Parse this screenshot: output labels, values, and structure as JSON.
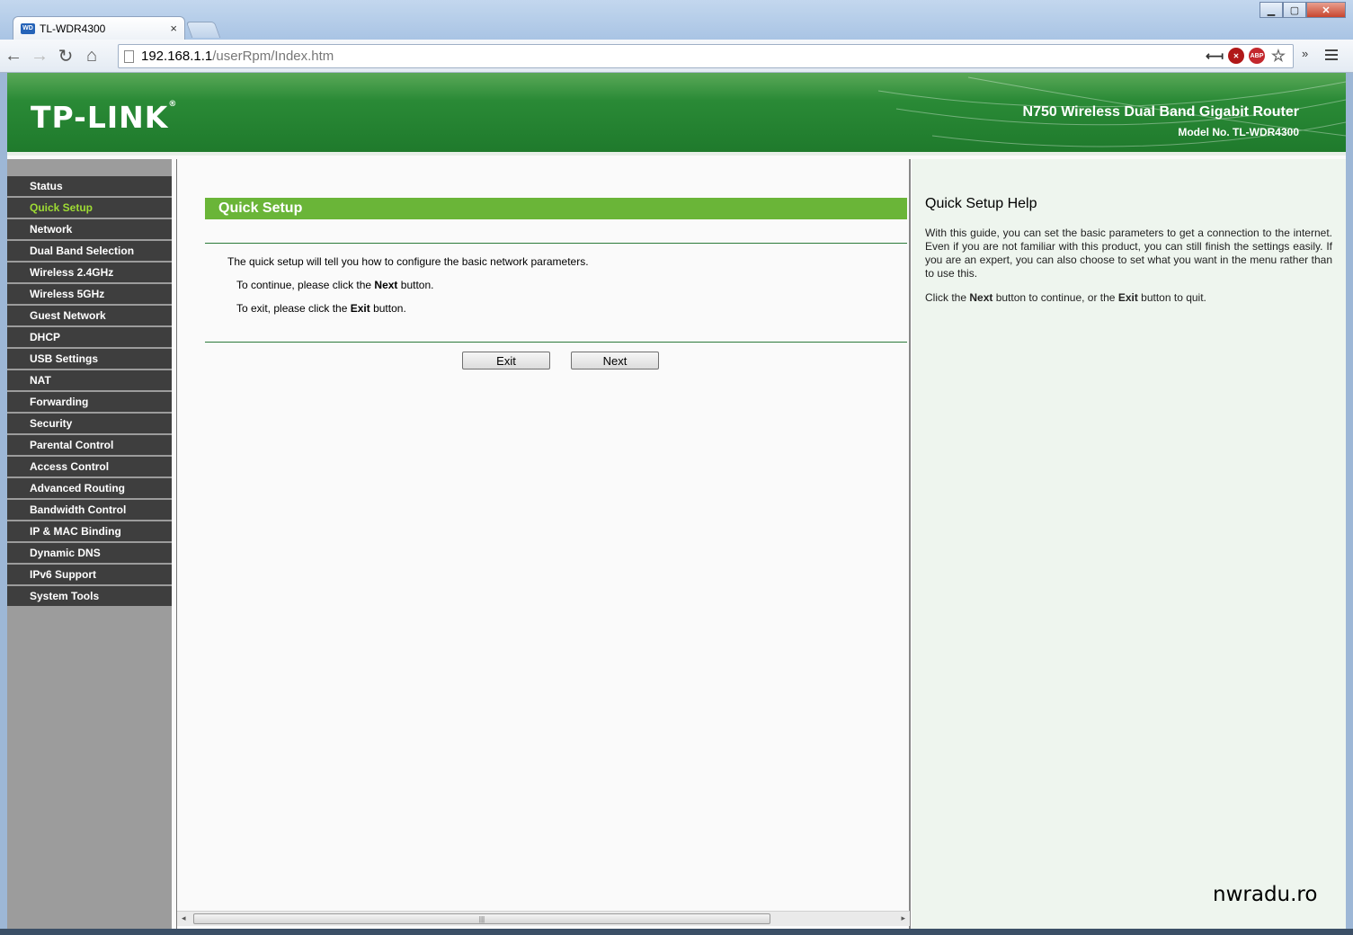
{
  "browser": {
    "tab_title": "TL-WDR4300",
    "tab_favicon": "WD",
    "tab_close": "×",
    "url_host": "192.168.1.1",
    "url_path": "/userRpm/Index.htm",
    "abp_label": "ABP"
  },
  "header": {
    "logo": "TP-LINK",
    "logo_mark": "®",
    "product": "N750 Wireless Dual Band Gigabit Router",
    "model": "Model No. TL-WDR4300"
  },
  "sidebar": {
    "items": [
      {
        "label": "Status"
      },
      {
        "label": "Quick Setup"
      },
      {
        "label": "Network"
      },
      {
        "label": "Dual Band Selection"
      },
      {
        "label": "Wireless 2.4GHz"
      },
      {
        "label": "Wireless 5GHz"
      },
      {
        "label": "Guest Network"
      },
      {
        "label": "DHCP"
      },
      {
        "label": "USB Settings"
      },
      {
        "label": "NAT"
      },
      {
        "label": "Forwarding"
      },
      {
        "label": "Security"
      },
      {
        "label": "Parental Control"
      },
      {
        "label": "Access Control"
      },
      {
        "label": "Advanced Routing"
      },
      {
        "label": "Bandwidth Control"
      },
      {
        "label": "IP & MAC Binding"
      },
      {
        "label": "Dynamic DNS"
      },
      {
        "label": "IPv6 Support"
      },
      {
        "label": "System Tools"
      }
    ],
    "active": "Quick Setup"
  },
  "main": {
    "title": "Quick Setup",
    "intro": "The quick setup will tell you how to configure the basic network parameters.",
    "continue_pre": "To continue, please click the ",
    "continue_bold": "Next",
    "continue_post": " button.",
    "exit_pre": "To exit, please click the ",
    "exit_bold": "Exit",
    "exit_post": " button.",
    "exit_button": "Exit",
    "next_button": "Next"
  },
  "help": {
    "title": "Quick Setup Help",
    "p1": "With this guide, you can set the basic parameters to get a connection to the internet. Even if you are not familiar with this product, you can still finish the settings easily. If you are an expert, you can also choose to set what you want in the menu rather than to use this.",
    "p2_pre": "Click the ",
    "p2_next": "Next",
    "p2_mid": " button to continue, or the ",
    "p2_exit": "Exit",
    "p2_post": " button to quit."
  },
  "watermark": "nwradu.ro",
  "colors": {
    "header_green": "#2a8a36",
    "section_green": "#6ab538",
    "menu_bg": "#3e3e3e",
    "menu_active": "#9edb34",
    "sidebar_bg": "#9c9c9c",
    "help_bg": "#eef5ee"
  }
}
